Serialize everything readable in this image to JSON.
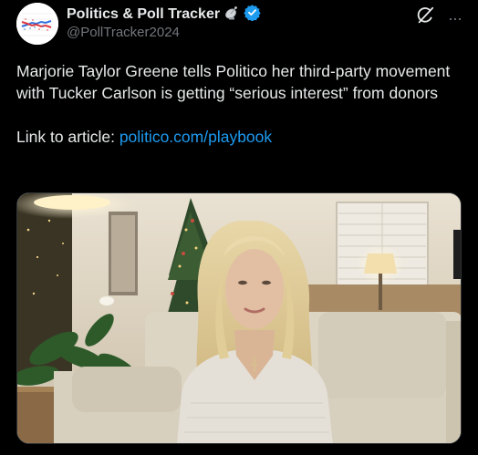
{
  "account": {
    "display_name": "Politics & Poll Tracker",
    "handle": "@PollTracker2024",
    "verified": true,
    "badge_icon": "satellite-dish-icon",
    "verified_icon": "verified-badge-icon",
    "verified_color": "#1d9bf0"
  },
  "actions": {
    "grok_icon": "grok-icon",
    "more_icon": "more-options-icon",
    "more_label": "···"
  },
  "post": {
    "text": "Marjorie Taylor Greene tells Politico her third-party movement with Tucker Carlson is getting “serious interest” from donors",
    "link_prefix": "Link to article: ",
    "link_text": "politico.com/playbook",
    "link_color": "#1d9bf0"
  },
  "media": {
    "type": "video-still",
    "subject": "woman-on-couch-with-christmas-tree"
  },
  "colors": {
    "background": "#000000",
    "text": "#e7e9ea",
    "secondary": "#71767b"
  }
}
